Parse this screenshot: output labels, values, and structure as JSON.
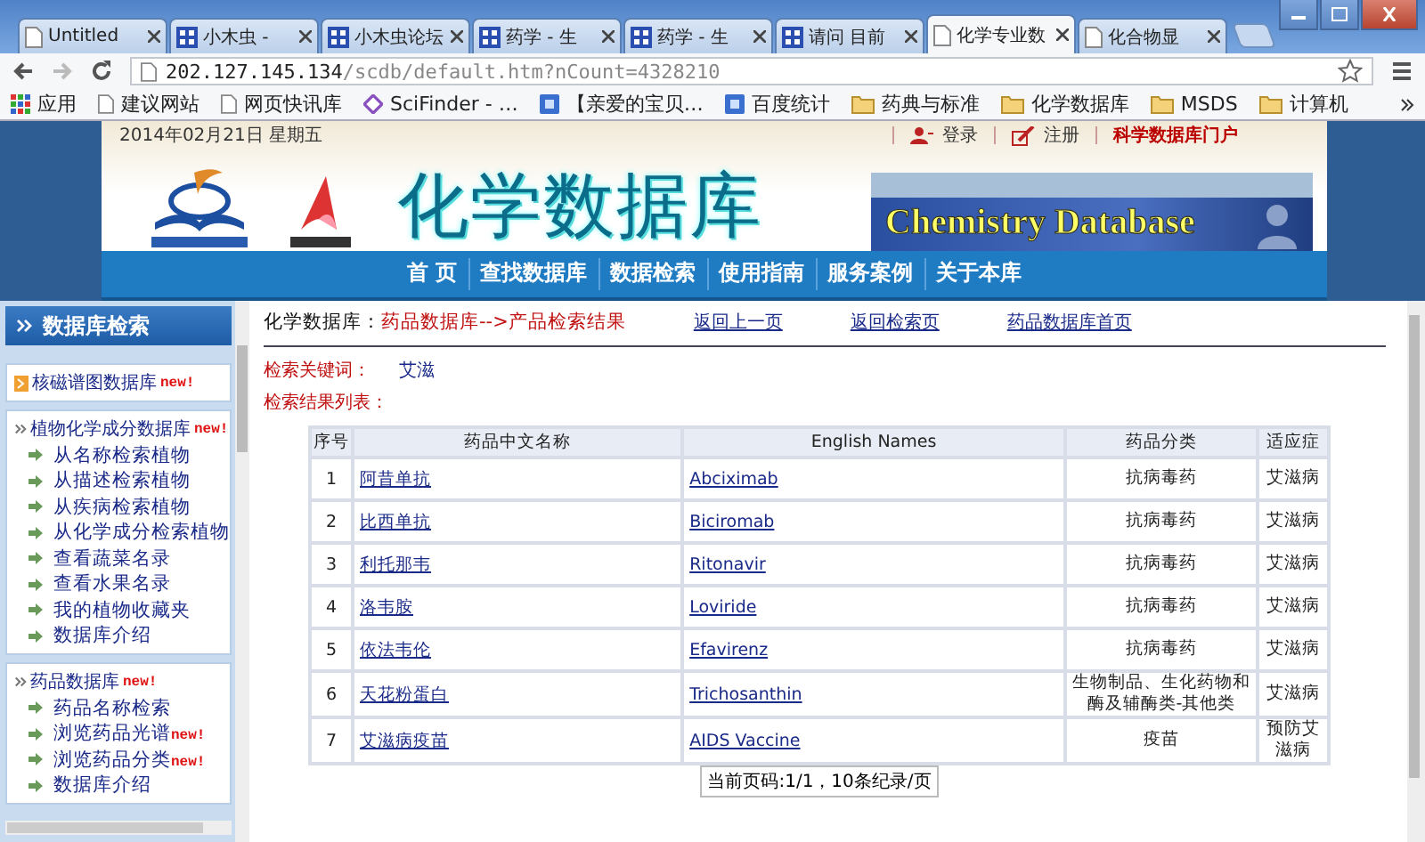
{
  "browser": {
    "tabs": [
      {
        "label": "Untitled",
        "selected": false,
        "kind": "page"
      },
      {
        "label": "小木虫 - ",
        "selected": false,
        "kind": "site"
      },
      {
        "label": "小木虫论坛",
        "selected": false,
        "kind": "site"
      },
      {
        "label": "药学 - 生",
        "selected": false,
        "kind": "site"
      },
      {
        "label": "药学 - 生",
        "selected": false,
        "kind": "site"
      },
      {
        "label": "请问 目前",
        "selected": false,
        "kind": "site"
      },
      {
        "label": "化学专业数",
        "selected": true,
        "kind": "page"
      },
      {
        "label": "化合物显",
        "selected": false,
        "kind": "page"
      }
    ],
    "address": {
      "host": "202.127.145.134",
      "path": "/scdb/default.htm?nCount=4328210"
    },
    "bookmarks": [
      {
        "label": "应用",
        "kind": "apps"
      },
      {
        "label": "建议网站",
        "kind": "page"
      },
      {
        "label": "网页快讯库",
        "kind": "page"
      },
      {
        "label": "SciFinder - …",
        "kind": "diamond"
      },
      {
        "label": "【亲爱的宝贝…",
        "kind": "square"
      },
      {
        "label": "百度统计",
        "kind": "square"
      },
      {
        "label": "药典与标准",
        "kind": "folder"
      },
      {
        "label": "化学数据库",
        "kind": "folder"
      },
      {
        "label": "MSDS",
        "kind": "folder"
      },
      {
        "label": "计算机",
        "kind": "folder"
      }
    ]
  },
  "header": {
    "date": "2014年02月21日  星期五",
    "links": [
      {
        "label": "登录",
        "kind": "login"
      },
      {
        "label": "注册",
        "kind": "register"
      },
      {
        "label": "科学数据库门户",
        "kind": "portal"
      }
    ],
    "title": "化学数据库",
    "banner": "Chemistry Database",
    "nav": [
      "首 页",
      "查找数据库",
      "数据检索",
      "使用指南",
      "服务案例",
      "关于本库"
    ]
  },
  "sidebar": {
    "title": "数据库检索",
    "sections": [
      {
        "title": "核磁谱图数据库",
        "badge": "new!",
        "kind": "link"
      },
      {
        "title": "植物化学成分数据库",
        "badge": "new!",
        "kind": "group",
        "items": [
          {
            "label": "从名称检索植物"
          },
          {
            "label": "从描述检索植物"
          },
          {
            "label": "从疾病检索植物"
          },
          {
            "label": "从化学成分检索植物"
          },
          {
            "label": "查看蔬菜名录"
          },
          {
            "label": "查看水果名录"
          },
          {
            "label": "我的植物收藏夹"
          },
          {
            "label": "数据库介绍"
          }
        ]
      },
      {
        "title": "药品数据库",
        "badge": "new!",
        "kind": "group",
        "items": [
          {
            "label": "药品名称检索"
          },
          {
            "label": "浏览药品光谱",
            "badge": "new!"
          },
          {
            "label": "浏览药品分类",
            "badge": "new!"
          },
          {
            "label": "数据库介绍"
          }
        ]
      }
    ]
  },
  "content": {
    "breadcrumb": {
      "root": "化学数据库：",
      "path": "药品数据库-->产品检索结果"
    },
    "links": [
      "返回上一页",
      "返回检索页",
      "药品数据库首页"
    ],
    "keyword_label": "检索关键词：",
    "keyword": "艾滋",
    "results_label": "检索结果列表：",
    "table": {
      "columns": [
        "序号",
        "药品中文名称",
        "English Names",
        "药品分类",
        "适应症"
      ],
      "rows": [
        {
          "no": "1",
          "cn": "阿昔单抗",
          "en": "Abciximab",
          "category": "抗病毒药",
          "indication": "艾滋病"
        },
        {
          "no": "2",
          "cn": "比西单抗",
          "en": "Biciromab",
          "category": "抗病毒药",
          "indication": "艾滋病"
        },
        {
          "no": "3",
          "cn": "利托那韦",
          "en": "Ritonavir",
          "category": "抗病毒药",
          "indication": "艾滋病"
        },
        {
          "no": "4",
          "cn": "洛韦胺",
          "en": "Loviride",
          "category": "抗病毒药",
          "indication": "艾滋病"
        },
        {
          "no": "5",
          "cn": "依法韦伦",
          "en": "Efavirenz",
          "category": "抗病毒药",
          "indication": "艾滋病"
        },
        {
          "no": "6",
          "cn": "天花粉蛋白",
          "en": "Trichosanthin",
          "category": "生物制品、生化药物和酶及辅酶类-其他类",
          "indication": "艾滋病"
        },
        {
          "no": "7",
          "cn": "艾滋病疫苗",
          "en": "AIDS Vaccine",
          "category": "疫苗",
          "indication": "预防艾滋病"
        }
      ]
    },
    "pager": "当前页码:1/1，10条纪录/页"
  }
}
